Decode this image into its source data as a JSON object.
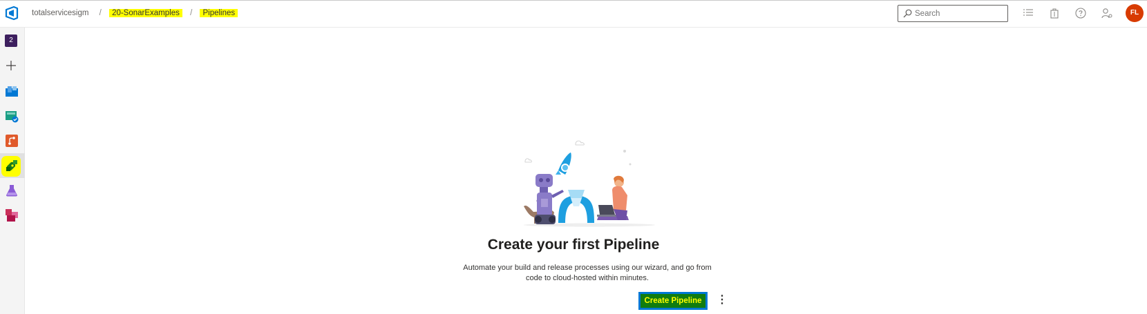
{
  "header": {
    "breadcrumb": {
      "organization": "totalservicesigm",
      "project": "20-SonarExamples",
      "page": "Pipelines",
      "separator": "/"
    },
    "search": {
      "placeholder": "Search"
    },
    "icons": [
      "work-items-icon",
      "marketplace-bag-icon",
      "help-icon",
      "user-settings-icon"
    ],
    "avatar": {
      "initials": "FL",
      "color": "#d83b01"
    }
  },
  "sidebar": {
    "project_badge": "2",
    "items": [
      {
        "name": "add-icon"
      },
      {
        "name": "boards-icon"
      },
      {
        "name": "test-plans-icon"
      },
      {
        "name": "repos-icon"
      },
      {
        "name": "pipelines-icon",
        "active": true
      },
      {
        "name": "test-flask-icon"
      },
      {
        "name": "artifacts-icon"
      }
    ]
  },
  "main": {
    "title": "Create your first Pipeline",
    "description": "Automate your build and release processes using our wizard, and go from code to cloud-hosted within minutes.",
    "create_button": "Create Pipeline",
    "more_glyph": "⋮"
  },
  "colors": {
    "accent": "#0078d4",
    "highlight": "#ffff00",
    "button_fill": "#107c10"
  }
}
